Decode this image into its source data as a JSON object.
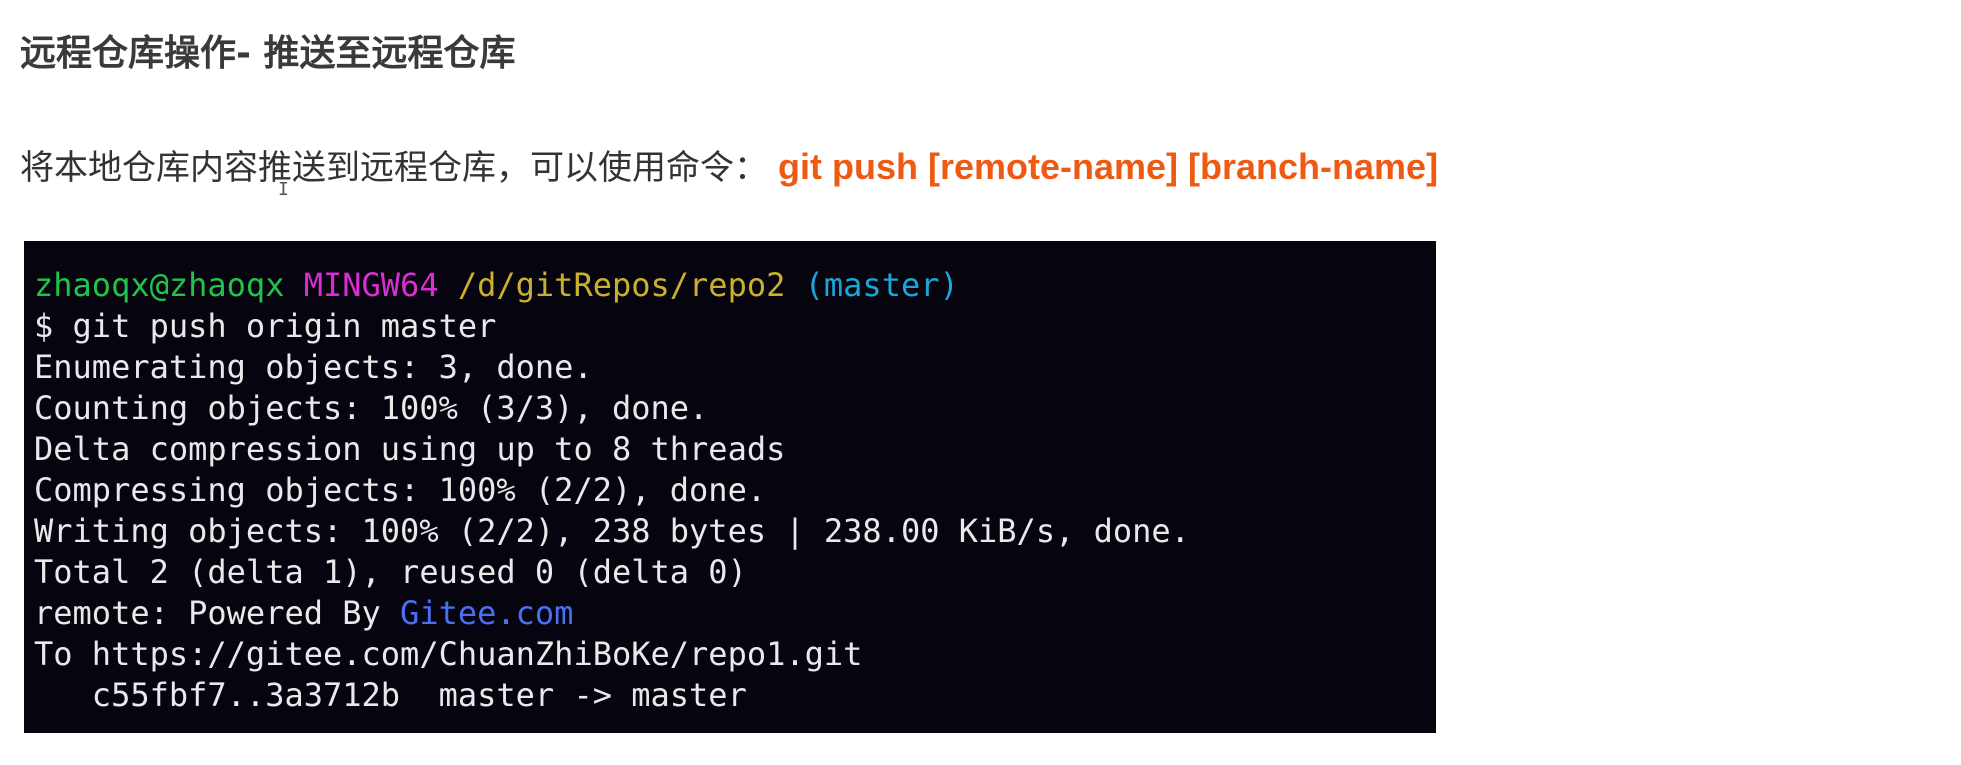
{
  "title": "远程仓库操作- 推送至远程仓库",
  "intro": {
    "text": "将本地仓库内容推送到远程仓库，可以使用命令：",
    "command": "git push [remote-name] [branch-name]"
  },
  "cursor_glyph": "I",
  "terminal": {
    "prompt": {
      "user": "zhaoqx@zhaoqx",
      "host": "MINGW64",
      "path": "/d/gitRepos/repo2",
      "branch": "(master)"
    },
    "command_line": "$ git push origin master",
    "output": [
      "Enumerating objects: 3, done.",
      "Counting objects: 100% (3/3), done.",
      "Delta compression using up to 8 threads",
      "Compressing objects: 100% (2/2), done.",
      "Writing objects: 100% (2/2), 238 bytes | 238.00 KiB/s, done.",
      "Total 2 (delta 1), reused 0 (delta 0)"
    ],
    "remote_prefix": "remote: Powered By ",
    "remote_link": "Gitee.com",
    "to_line": "To https://gitee.com/ChuanZhiBoKe/repo1.git",
    "ref_update": "   c55fbf7..3a3712b  master -> master"
  },
  "colors": {
    "command_accent": "#ef5a12",
    "terminal_bg": "#05040f",
    "prompt_user": "#21c44a",
    "prompt_host": "#d92fd2",
    "prompt_path": "#c9b12f",
    "prompt_branch": "#1aa6d8",
    "link": "#4b6ff2"
  }
}
